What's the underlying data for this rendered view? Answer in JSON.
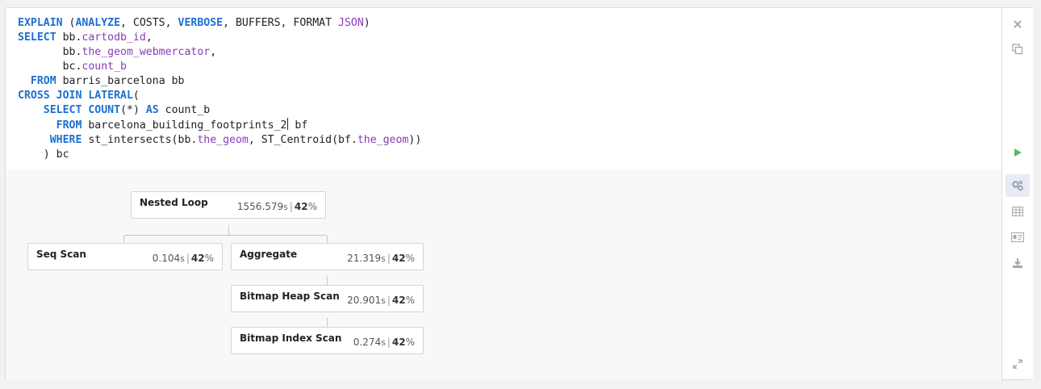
{
  "editor": {
    "lines": [
      {
        "key": "l1",
        "tokens": [
          {
            "t": "EXPLAIN",
            "c": "kw"
          },
          {
            "t": " (",
            "c": ""
          },
          {
            "t": "ANALYZE",
            "c": "kw"
          },
          {
            "t": ", COSTS, ",
            "c": ""
          },
          {
            "t": "VERBOSE",
            "c": "kw"
          },
          {
            "t": ", BUFFERS, FORMAT ",
            "c": ""
          },
          {
            "t": "JSON",
            "c": "prop"
          },
          {
            "t": ")",
            "c": ""
          }
        ]
      },
      {
        "key": "l2",
        "tokens": [
          {
            "t": "SELECT",
            "c": "kw"
          },
          {
            "t": " bb.",
            "c": ""
          },
          {
            "t": "cartodb_id",
            "c": "prop"
          },
          {
            "t": ",",
            "c": ""
          }
        ]
      },
      {
        "key": "l3",
        "tokens": [
          {
            "t": "       bb.",
            "c": ""
          },
          {
            "t": "the_geom_webmercator",
            "c": "prop"
          },
          {
            "t": ",",
            "c": ""
          }
        ]
      },
      {
        "key": "l4",
        "tokens": [
          {
            "t": "       bc.",
            "c": ""
          },
          {
            "t": "count_b",
            "c": "prop"
          }
        ]
      },
      {
        "key": "l5",
        "tokens": [
          {
            "t": "  ",
            "c": ""
          },
          {
            "t": "FROM",
            "c": "kw"
          },
          {
            "t": " barris_barcelona bb",
            "c": ""
          }
        ]
      },
      {
        "key": "l6",
        "tokens": [
          {
            "t": "CROSS JOIN LATERAL",
            "c": "kw"
          },
          {
            "t": "(",
            "c": ""
          }
        ]
      },
      {
        "key": "l7",
        "tokens": [
          {
            "t": "    ",
            "c": ""
          },
          {
            "t": "SELECT",
            "c": "kw"
          },
          {
            "t": " ",
            "c": ""
          },
          {
            "t": "COUNT",
            "c": "kw"
          },
          {
            "t": "(*) ",
            "c": ""
          },
          {
            "t": "AS",
            "c": "kw"
          },
          {
            "t": " count_b",
            "c": ""
          }
        ]
      },
      {
        "key": "l8",
        "tokens": [
          {
            "t": "      ",
            "c": ""
          },
          {
            "t": "FROM",
            "c": "kw"
          },
          {
            "t": " barcelona_building_footprints_2",
            "c": ""
          },
          {
            "t": "|cursor|",
            "c": "cursor"
          },
          {
            "t": " bf",
            "c": ""
          }
        ]
      },
      {
        "key": "l9",
        "tokens": [
          {
            "t": "     ",
            "c": ""
          },
          {
            "t": "WHERE",
            "c": "kw"
          },
          {
            "t": " st_intersects(bb.",
            "c": ""
          },
          {
            "t": "the_geom",
            "c": "prop"
          },
          {
            "t": ", ST_Centroid(bf.",
            "c": ""
          },
          {
            "t": "the_geom",
            "c": "prop"
          },
          {
            "t": "))",
            "c": ""
          }
        ]
      },
      {
        "key": "l10",
        "tokens": [
          {
            "t": "    ) bc",
            "c": ""
          }
        ]
      }
    ]
  },
  "plan": {
    "nodes": {
      "nested_loop": {
        "name": "Nested Loop",
        "time": "1556.579",
        "unit": "s",
        "pct": "42",
        "pct_sign": "%"
      },
      "seq_scan": {
        "name": "Seq Scan",
        "time": "0.104",
        "unit": "s",
        "pct": "42",
        "pct_sign": "%"
      },
      "aggregate": {
        "name": "Aggregate",
        "time": "21.319",
        "unit": "s",
        "pct": "42",
        "pct_sign": "%"
      },
      "bitmap_heap_scan": {
        "name": "Bitmap Heap Scan",
        "time": "20.901",
        "unit": "s",
        "pct": "42",
        "pct_sign": "%"
      },
      "bitmap_index_scan": {
        "name": "Bitmap Index Scan",
        "time": "0.274",
        "unit": "s",
        "pct": "42",
        "pct_sign": "%"
      }
    },
    "separator": "|"
  },
  "toolbar": {
    "buttons": [
      {
        "icon": "close-icon"
      },
      {
        "icon": "copy-icon"
      },
      {
        "icon": "run-icon"
      },
      {
        "icon": "settings-gears-icon"
      },
      {
        "icon": "table-icon"
      },
      {
        "icon": "card-icon"
      },
      {
        "icon": "download-icon"
      },
      {
        "icon": "expand-icon"
      }
    ]
  },
  "colors": {
    "keyword": "#1d6fd1",
    "property": "#8a3ab9",
    "run": "#5cb85c",
    "toolbar_icon": "#a8a8a8"
  }
}
